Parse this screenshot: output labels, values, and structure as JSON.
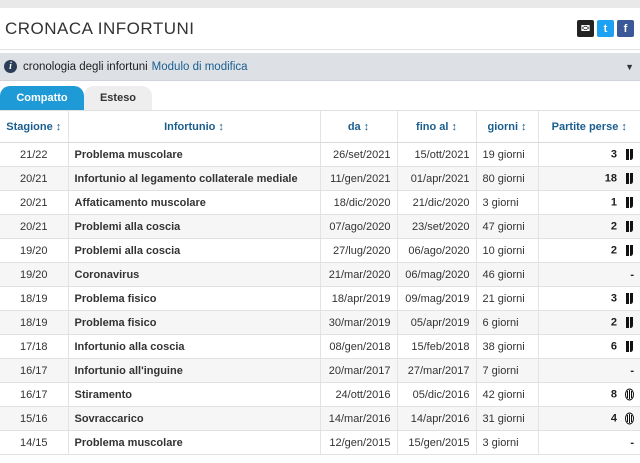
{
  "header": {
    "title": "CRONACA INFORTUNI"
  },
  "info": {
    "text": "cronologia degli infortuni",
    "link": "Modulo di modifica"
  },
  "tabs": [
    {
      "label": "Compatto"
    },
    {
      "label": "Esteso"
    }
  ],
  "columns": {
    "season": "Stagione",
    "injury": "Infortunio",
    "from": "da",
    "until": "fino al",
    "days": "giorni",
    "missed": "Partite perse"
  },
  "sort_icon": "↕",
  "rows": [
    {
      "season": "21/22",
      "injury": "Problema muscolare",
      "from": "26/set/2021",
      "until": "15/ott/2021",
      "days": "19 giorni",
      "missed": "3",
      "club_icon": "juventus-new"
    },
    {
      "season": "20/21",
      "injury": "Infortunio al legamento collaterale mediale",
      "from": "11/gen/2021",
      "until": "01/apr/2021",
      "days": "80 giorni",
      "missed": "18",
      "club_icon": "juventus-new"
    },
    {
      "season": "20/21",
      "injury": "Affaticamento muscolare",
      "from": "18/dic/2020",
      "until": "21/dic/2020",
      "days": "3 giorni",
      "missed": "1",
      "club_icon": "juventus-new"
    },
    {
      "season": "20/21",
      "injury": "Problemi alla coscia",
      "from": "07/ago/2020",
      "until": "23/set/2020",
      "days": "47 giorni",
      "missed": "2",
      "club_icon": "juventus-new"
    },
    {
      "season": "19/20",
      "injury": "Problemi alla coscia",
      "from": "27/lug/2020",
      "until": "06/ago/2020",
      "days": "10 giorni",
      "missed": "2",
      "club_icon": "juventus-new"
    },
    {
      "season": "19/20",
      "injury": "Coronavirus",
      "from": "21/mar/2020",
      "until": "06/mag/2020",
      "days": "46 giorni",
      "missed": "-",
      "club_icon": ""
    },
    {
      "season": "18/19",
      "injury": "Problema fisico",
      "from": "18/apr/2019",
      "until": "09/mag/2019",
      "days": "21 giorni",
      "missed": "3",
      "club_icon": "juventus-new"
    },
    {
      "season": "18/19",
      "injury": "Problema fisico",
      "from": "30/mar/2019",
      "until": "05/apr/2019",
      "days": "6 giorni",
      "missed": "2",
      "club_icon": "juventus-new"
    },
    {
      "season": "17/18",
      "injury": "Infortunio alla coscia",
      "from": "08/gen/2018",
      "until": "15/feb/2018",
      "days": "38 giorni",
      "missed": "6",
      "club_icon": "juventus-new"
    },
    {
      "season": "16/17",
      "injury": "Infortunio all'inguine",
      "from": "20/mar/2017",
      "until": "27/mar/2017",
      "days": "7 giorni",
      "missed": "-",
      "club_icon": ""
    },
    {
      "season": "16/17",
      "injury": "Stiramento",
      "from": "24/ott/2016",
      "until": "05/dic/2016",
      "days": "42 giorni",
      "missed": "8",
      "club_icon": "juventus-old"
    },
    {
      "season": "15/16",
      "injury": "Sovraccarico",
      "from": "14/mar/2016",
      "until": "14/apr/2016",
      "days": "31 giorni",
      "missed": "4",
      "club_icon": "juventus-old"
    },
    {
      "season": "14/15",
      "injury": "Problema muscolare",
      "from": "12/gen/2015",
      "until": "15/gen/2015",
      "days": "3 giorni",
      "missed": "-",
      "club_icon": ""
    }
  ]
}
